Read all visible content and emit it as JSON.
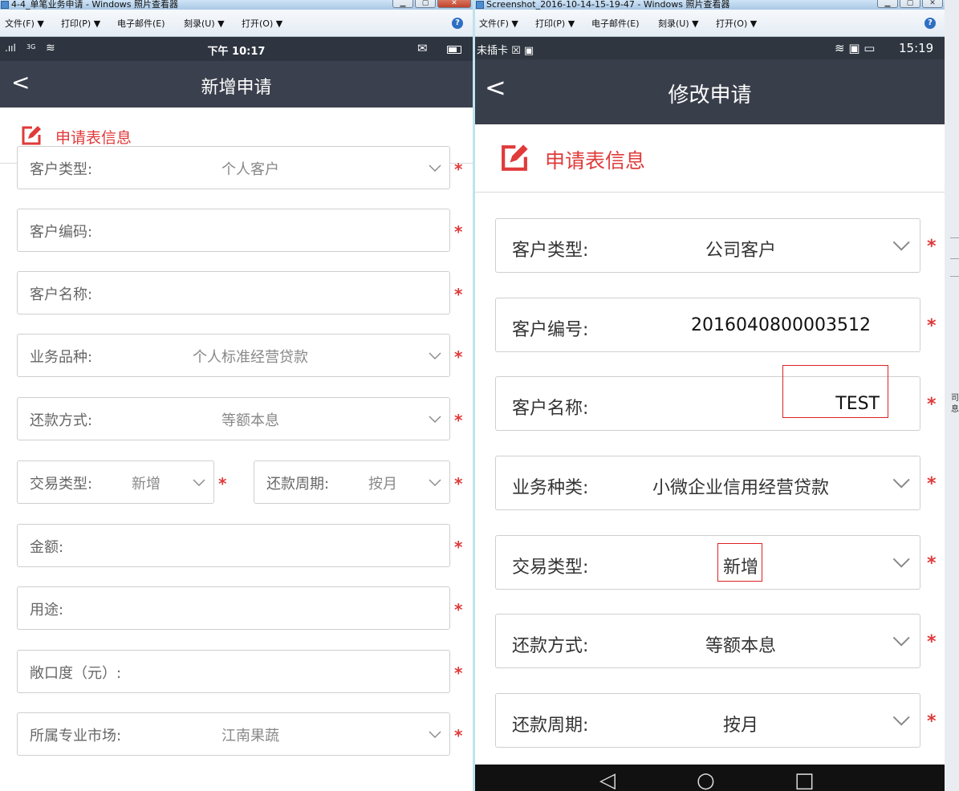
{
  "left_window": {
    "title": "4-4_单笔业务申请 - Windows 照片查看器",
    "menu": [
      "文件(F) ▼",
      "打印(P) ▼",
      "电子邮件(E)",
      "刻录(U) ▼",
      "打开(O) ▼"
    ],
    "phone": {
      "status_signal": ".ııl",
      "status_net": "3G",
      "status_wifi": "≋",
      "status_time": "下午 10:17",
      "status_mail": "✉",
      "nav_back": "<",
      "nav_title": "新增申请",
      "section_title": "申请表信息",
      "fields": [
        {
          "label": "客户类型:",
          "value": "个人客户",
          "dropdown": true
        },
        {
          "label": "客户编码:",
          "value": "",
          "dropdown": false
        },
        {
          "label": "客户名称:",
          "value": "",
          "dropdown": false
        },
        {
          "label": "业务品种:",
          "value": "个人标准经营贷款",
          "dropdown": true
        },
        {
          "label": "还款方式:",
          "value": "等额本息",
          "dropdown": true
        },
        {
          "label": "交易类型:",
          "value": "新增",
          "dropdown": true
        },
        {
          "label": "还款周期:",
          "value": "按月",
          "dropdown": true
        },
        {
          "label": "金额:",
          "value": "",
          "dropdown": false
        },
        {
          "label": "用途:",
          "value": "",
          "dropdown": false
        },
        {
          "label": "敞口度（元）:",
          "value": "",
          "dropdown": false
        },
        {
          "label": "所属专业市场:",
          "value": "江南果蔬",
          "dropdown": true
        }
      ],
      "required_mark": "*"
    }
  },
  "right_window": {
    "title": "Screenshot_2016-10-14-15-19-47 - Windows 照片查看器",
    "menu": [
      "文件(F) ▼",
      "打印(P) ▼",
      "电子邮件(E)",
      "刻录(U) ▼",
      "打开(O) ▼"
    ],
    "phone": {
      "status_left": "未插卡 ☒ ▣",
      "status_icons": "≋ ▣ ▭",
      "status_time": "15:19",
      "nav_back": "<",
      "nav_title": "修改申请",
      "section_title": "申请表信息",
      "fields": [
        {
          "label": "客户类型:",
          "value": "公司客户",
          "dropdown": true
        },
        {
          "label": "客户编号:",
          "value": "2016040800003512",
          "dropdown": false
        },
        {
          "label": "客户名称:",
          "value": "TEST",
          "dropdown": false
        },
        {
          "label": "业务种类:",
          "value": "小微企业信用经营贷款",
          "dropdown": true
        },
        {
          "label": "交易类型:",
          "value": "新增",
          "dropdown": true
        },
        {
          "label": "还款方式:",
          "value": "等额本息",
          "dropdown": true
        },
        {
          "label": "还款周期:",
          "value": "按月",
          "dropdown": true
        }
      ],
      "required_mark": "*",
      "android_nav": [
        "◁",
        "○",
        "□"
      ]
    }
  },
  "edge_text": [
    "司",
    "息"
  ],
  "window_buttons": [
    "▁",
    "▢",
    "✕"
  ],
  "colors": {
    "accent_red": "#e03a3a",
    "navbar": "#3a404d",
    "statusbar": "#2e3440"
  }
}
